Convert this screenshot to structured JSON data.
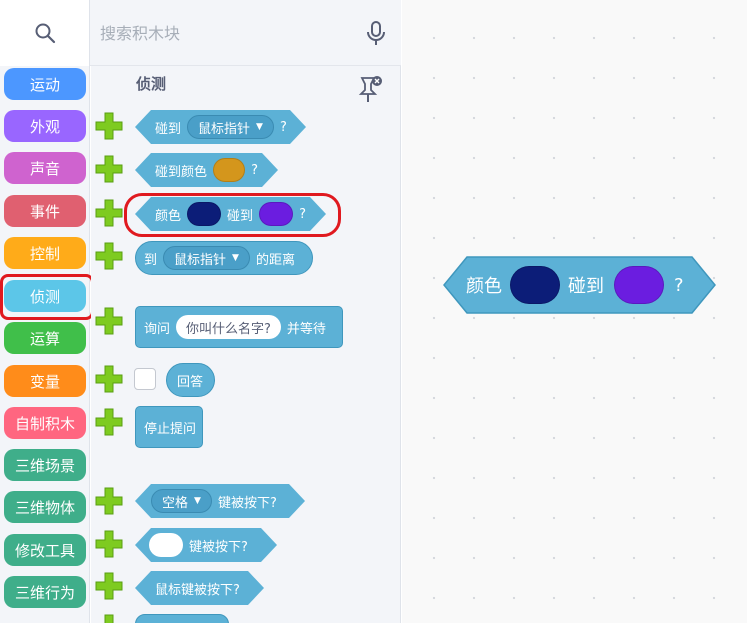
{
  "search": {
    "placeholder": "搜索积木块"
  },
  "categories": [
    {
      "label": "运动",
      "color": "#4c97ff"
    },
    {
      "label": "外观",
      "color": "#9966ff"
    },
    {
      "label": "声音",
      "color": "#cf63cf"
    },
    {
      "label": "事件",
      "color": "#e06070"
    },
    {
      "label": "控制",
      "color": "#ffab19"
    },
    {
      "label": "侦测",
      "color": "#5cc6e8"
    },
    {
      "label": "运算",
      "color": "#40bf4a"
    },
    {
      "label": "变量",
      "color": "#ff8c1a"
    },
    {
      "label": "自制积木",
      "color": "#ff6680"
    },
    {
      "label": "三维场景",
      "color": "#3fae8a"
    },
    {
      "label": "三维物体",
      "color": "#3fae8a"
    },
    {
      "label": "修改工具",
      "color": "#3fae8a"
    },
    {
      "label": "三维行为",
      "color": "#3fae8a"
    }
  ],
  "palette": {
    "title": "侦测",
    "blocks": {
      "touching": {
        "prefix": "碰到",
        "menu": "鼠标指针",
        "suffix": "?"
      },
      "touching_color": {
        "prefix": "碰到颜色",
        "suffix": "?",
        "color": "#d4961c"
      },
      "color_touching": {
        "prefix": "颜色",
        "mid": "碰到",
        "suffix": "?",
        "color1": "#0c1d78",
        "color2": "#6b1de0"
      },
      "distance": {
        "prefix": "到",
        "menu": "鼠标指针",
        "suffix": "的距离"
      },
      "ask": {
        "prefix": "询问",
        "input": "你叫什么名字?",
        "suffix": "并等待"
      },
      "answer": {
        "label": "回答"
      },
      "stop_ask": {
        "label": "停止提问"
      },
      "key_pressed": {
        "menu": "空格",
        "suffix": "键被按下?"
      },
      "key_pressed_blank": {
        "suffix": "键被按下?"
      },
      "mouse_down": {
        "label": "鼠标键被按下?"
      }
    }
  },
  "workspace": {
    "block": {
      "prefix": "颜色",
      "mid": "碰到",
      "suffix": "?",
      "color1": "#0c1d78",
      "color2": "#6b1de0"
    }
  }
}
